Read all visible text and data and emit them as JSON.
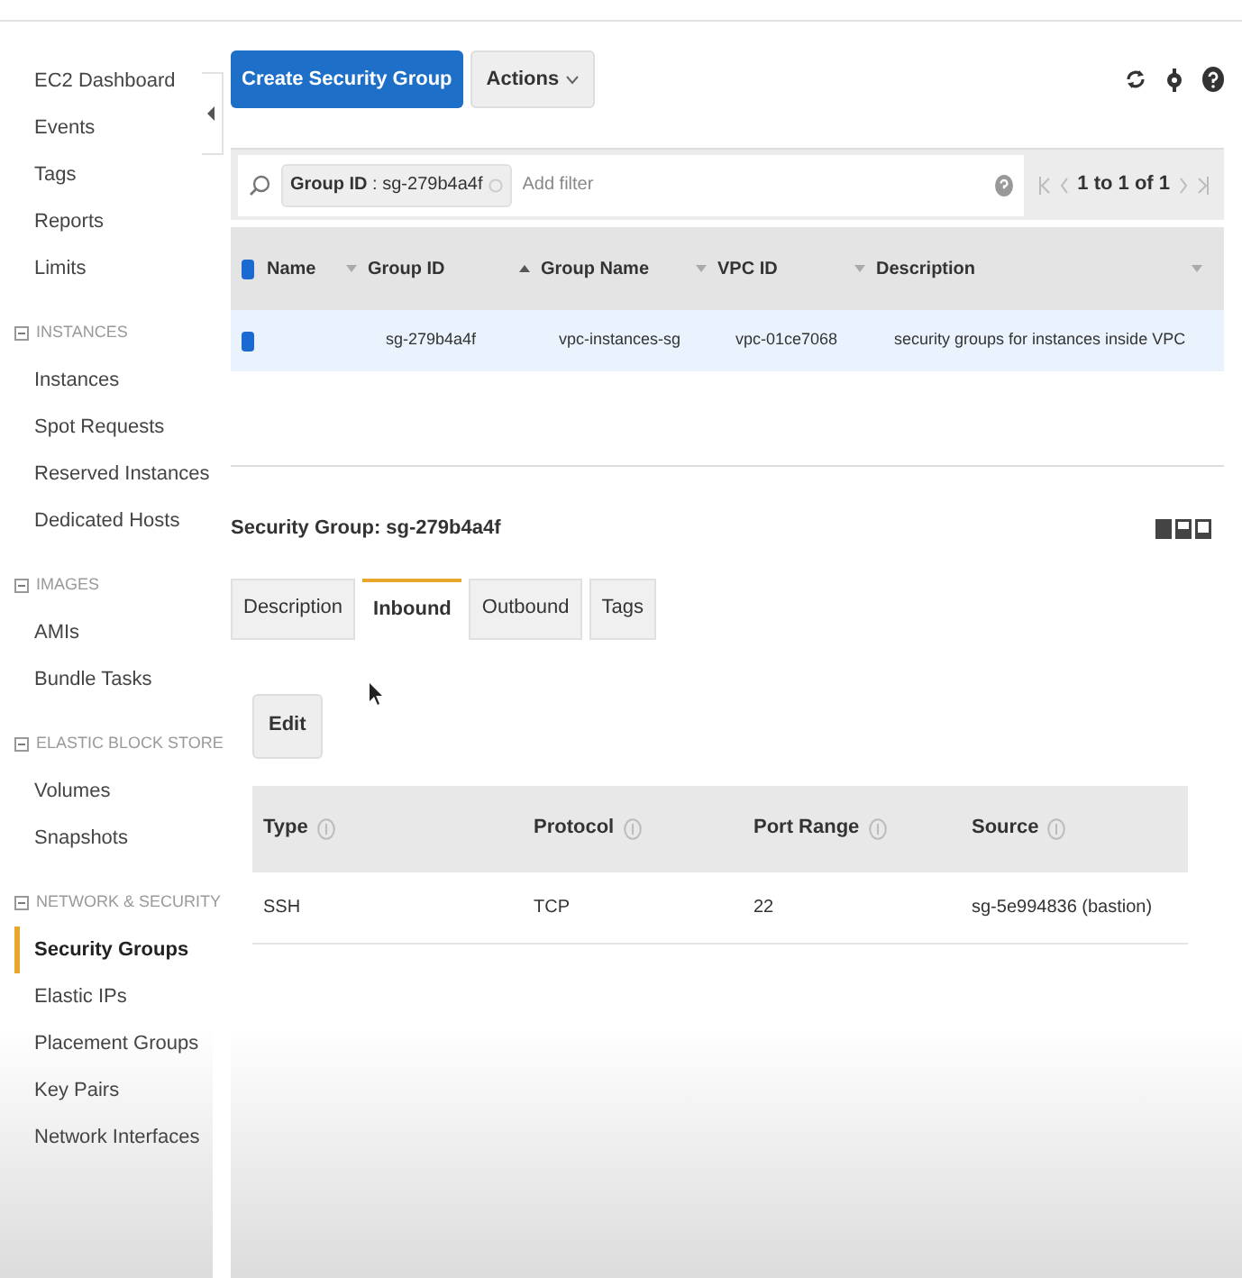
{
  "sidebar": {
    "items": [
      {
        "label": "EC2 Dashboard",
        "selected": false
      },
      {
        "label": "Events",
        "selected": false
      },
      {
        "label": "Tags",
        "selected": false
      },
      {
        "label": "Reports",
        "selected": false
      },
      {
        "label": "Limits",
        "selected": false
      }
    ],
    "sections": [
      {
        "title": "INSTANCES",
        "expanded": true,
        "items": [
          {
            "label": "Instances",
            "selected": false
          },
          {
            "label": "Spot Requests",
            "selected": false
          },
          {
            "label": "Reserved Instances",
            "selected": false
          },
          {
            "label": "Dedicated Hosts",
            "selected": false
          }
        ]
      },
      {
        "title": "IMAGES",
        "expanded": true,
        "items": [
          {
            "label": "AMIs",
            "selected": false
          },
          {
            "label": "Bundle Tasks",
            "selected": false
          }
        ]
      },
      {
        "title": "ELASTIC BLOCK STORE",
        "expanded": true,
        "items": [
          {
            "label": "Volumes",
            "selected": false
          },
          {
            "label": "Snapshots",
            "selected": false
          }
        ]
      },
      {
        "title": "NETWORK & SECURITY",
        "expanded": true,
        "items": [
          {
            "label": "Security Groups",
            "selected": true
          },
          {
            "label": "Elastic IPs",
            "selected": false
          },
          {
            "label": "Placement Groups",
            "selected": false
          },
          {
            "label": "Key Pairs",
            "selected": false
          },
          {
            "label": "Network Interfaces",
            "selected": false
          }
        ]
      }
    ]
  },
  "toolbar": {
    "primary_button": "Create Security Group",
    "actions_button": "Actions"
  },
  "filter": {
    "token": "**Group ID** : sg-279b4a4f",
    "placeholder": "Add filter",
    "pagination": "1 to 1 of 1"
  },
  "table": {
    "all_checked": true,
    "columns": [
      {
        "label": "Name",
        "sorted": false
      },
      {
        "label": "Group ID",
        "sorted": true
      },
      {
        "label": "Group Name",
        "sorted": false
      },
      {
        "label": "VPC ID",
        "sorted": false
      },
      {
        "label": "Description",
        "sorted": false
      }
    ],
    "rows": [
      {
        "selected": true,
        "cells": [
          "",
          "sg-279b4a4f",
          "vpc-instances-sg",
          "vpc-01ce7068",
          "security groups for instances inside VPC"
        ]
      }
    ]
  },
  "details": {
    "title": "Security Group: sg-279b4a4f",
    "tabs": [
      {
        "label": "Description",
        "selected": false
      },
      {
        "label": "Inbound",
        "selected": true
      },
      {
        "label": "Outbound",
        "selected": false
      },
      {
        "label": "Tags",
        "selected": false
      }
    ],
    "edit_button": "Edit",
    "rules": {
      "columns": [
        "Type",
        "Protocol",
        "Port Range",
        "Source"
      ],
      "rows": [
        [
          "SSH",
          "TCP",
          "22",
          "sg-5e994836 (bastion)"
        ]
      ]
    }
  }
}
